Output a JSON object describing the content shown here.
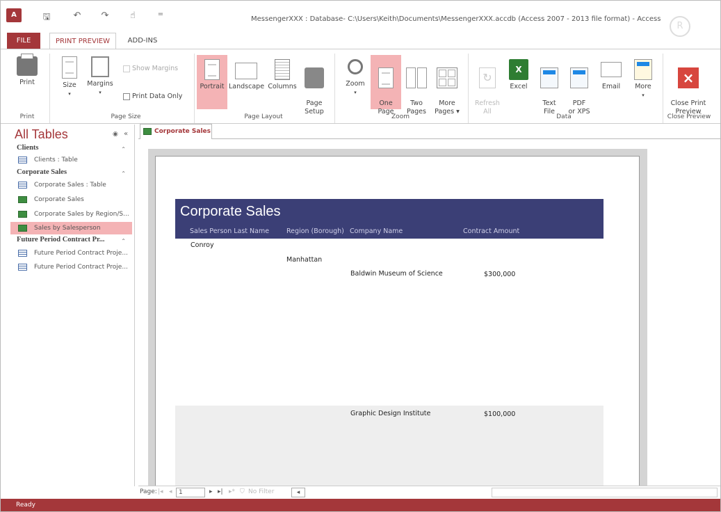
{
  "window": {
    "title": "MessengerXXX : Database- C:\\Users\\Keith\\Documents\\MessengerXXX.accdb (Access 2007 - 2013 file format) - Access",
    "qat_undo_glyph": "↶",
    "qat_redo_glyph": "↷",
    "qat_save_glyph": "🖫",
    "qat_touch_glyph": "☝",
    "qat_more_glyph": "="
  },
  "tabs": {
    "file": "FILE",
    "print_preview": "PRINT PREVIEW",
    "addins": "ADD-INS"
  },
  "ribbon": {
    "print": {
      "label": "Print",
      "group": "Print"
    },
    "size": {
      "label": "Size"
    },
    "margins": {
      "label": "Margins"
    },
    "show_margins": {
      "label": "Show Margins"
    },
    "print_data_only": {
      "label": "Print Data Only"
    },
    "page_size_group": "Page Size",
    "portrait": {
      "label": "Portrait"
    },
    "landscape": {
      "label": "Landscape"
    },
    "columns": {
      "label": "Columns"
    },
    "page_setup": {
      "label": "Page\nSetup"
    },
    "page_layout_group": "Page Layout",
    "zoom": {
      "label": "Zoom"
    },
    "one_page": {
      "label": "One\nPage"
    },
    "two_pages": {
      "label": "Two\nPages"
    },
    "more_pages": {
      "label": "More\nPages ▾"
    },
    "zoom_group": "Zoom",
    "refresh_all": {
      "label": "Refresh\nAll"
    },
    "excel": {
      "label": "Excel"
    },
    "text_file": {
      "label": "Text\nFile"
    },
    "pdf_xps": {
      "label": "PDF\nor XPS"
    },
    "email": {
      "label": "Email"
    },
    "more": {
      "label": "More"
    },
    "data_group": "Data",
    "close_preview": {
      "label": "Close Print\nPreview"
    },
    "close_preview_group": "Close Preview"
  },
  "nav": {
    "title": "All Tables",
    "groups": [
      {
        "header": "Clients",
        "items": [
          {
            "label": "Clients : Table",
            "type": "table"
          }
        ]
      },
      {
        "header": "Corporate Sales",
        "items": [
          {
            "label": "Corporate Sales : Table",
            "type": "table"
          },
          {
            "label": "Corporate Sales",
            "type": "report"
          },
          {
            "label": "Corporate Sales by Region/S...",
            "type": "report"
          },
          {
            "label": "Sales by Salesperson",
            "type": "report",
            "selected": true
          }
        ]
      },
      {
        "header": "Future Period Contract Pr...",
        "items": [
          {
            "label": "Future Period Contract Proje...",
            "type": "table"
          },
          {
            "label": "Future Period Contract Proje...",
            "type": "table"
          }
        ]
      }
    ]
  },
  "document_tab": "Corporate Sales",
  "report": {
    "title": "Corporate Sales",
    "columns": [
      "Sales Person Last Name",
      "Region (Borough)",
      "Company Name",
      "Contract Amount"
    ],
    "salesperson": "Conroy",
    "region": "Manhattan",
    "rows": [
      {
        "company": "Baldwin Museum of Science",
        "amount": "$300,000"
      },
      {
        "company": "Graphic Design Institute",
        "amount": "$100,000"
      }
    ]
  },
  "record_nav": {
    "page_label": "Page:",
    "page_value": "1",
    "filter_label": "No Filter"
  },
  "status": {
    "text": "Ready"
  }
}
